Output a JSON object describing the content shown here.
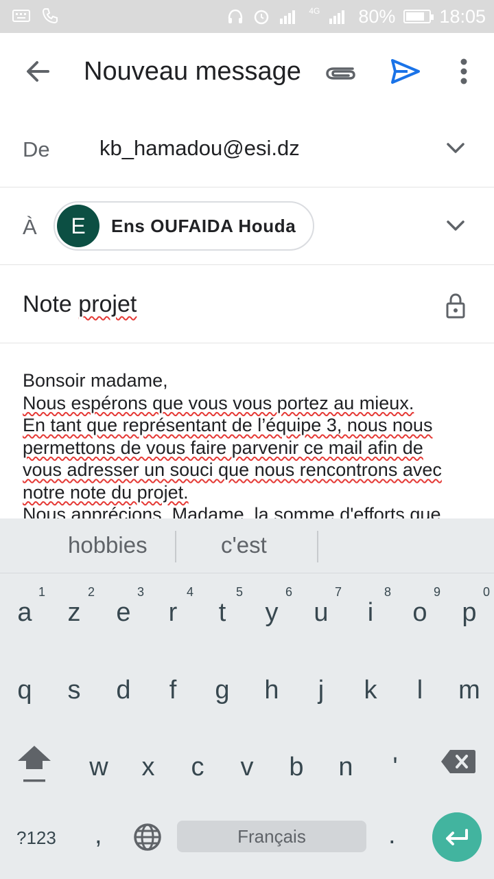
{
  "status_bar": {
    "battery_percent": "80%",
    "battery_level": 0.8,
    "time": "18:05",
    "network": "4G"
  },
  "app_bar": {
    "title": "Nouveau message",
    "icons": [
      "back-arrow-icon",
      "attachment-icon",
      "send-icon",
      "more-vert-icon"
    ]
  },
  "compose": {
    "from_label": "De",
    "from_value": "kb_hamadou@esi.dz",
    "to_label": "À",
    "recipient_initial": "E",
    "recipient_name": "Ens OUFAIDA Houda",
    "subject_word1": "Note",
    "subject_word2": "projet",
    "body_lines": [
      "Bonsoir madame,",
      "Nous espérons que vous vous portez au mieux.",
      "En tant que représentant de l’équipe 3, nous nous",
      "permettons de vous faire parvenir ce mail afin de",
      "vous adresser un souci que nous rencontrons avec",
      "notre note du projet.",
      "Nous apprécions, Madame, la somme d'efforts que"
    ]
  },
  "keyboard": {
    "suggestions": [
      "hobbies",
      "c'est"
    ],
    "row1": [
      {
        "ch": "a",
        "num": "1"
      },
      {
        "ch": "z",
        "num": "2"
      },
      {
        "ch": "e",
        "num": "3"
      },
      {
        "ch": "r",
        "num": "4"
      },
      {
        "ch": "t",
        "num": "5"
      },
      {
        "ch": "y",
        "num": "6"
      },
      {
        "ch": "u",
        "num": "7"
      },
      {
        "ch": "i",
        "num": "8"
      },
      {
        "ch": "o",
        "num": "9"
      },
      {
        "ch": "p",
        "num": "0"
      }
    ],
    "row2": [
      "q",
      "s",
      "d",
      "f",
      "g",
      "h",
      "j",
      "k",
      "l",
      "m"
    ],
    "row3": [
      "w",
      "x",
      "c",
      "v",
      "b",
      "n",
      "'"
    ],
    "symbols_label": "?123",
    "comma": ",",
    "space_label": "Français",
    "period": "."
  },
  "colors": {
    "accent_send": "#1a73e8",
    "avatar_bg": "#0c4f43",
    "enter_bg": "#42b49f",
    "spellcheck": "#e53935"
  }
}
